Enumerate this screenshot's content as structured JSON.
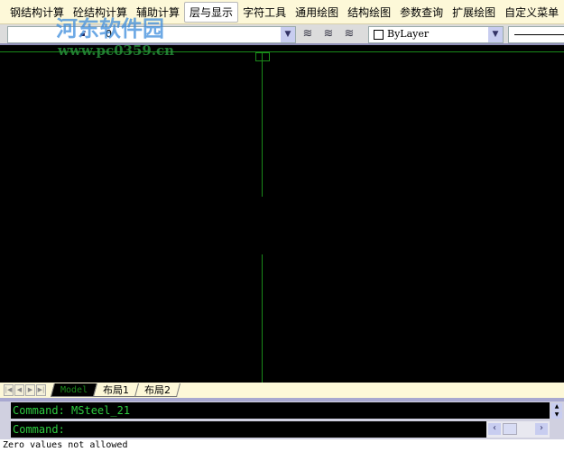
{
  "menu": [
    "钢结构计算",
    "砼结构计算",
    "辅助计算",
    "层与显示",
    "字符工具",
    "通用绘图",
    "结构绘图",
    "参数查询",
    "扩展绘图",
    "自定义菜单"
  ],
  "toolbar": {
    "layer_value": "0",
    "color_value": "ByLayer"
  },
  "tabs": [
    "Model",
    "布局1",
    "布局2"
  ],
  "command": {
    "history": "Command: MSteel_21",
    "prompt": "Command:"
  },
  "status": "Zero values not allowed",
  "watermark": {
    "title": "河东软件园",
    "url": "www.pc0359.cn"
  },
  "colors": {
    "canvas": "#000000",
    "command_text": "#2ecc40",
    "menubar": "#fdf8d8"
  }
}
